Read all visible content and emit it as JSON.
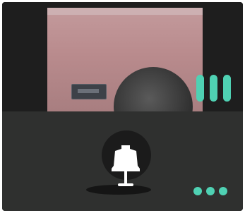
{
  "screen": {
    "camera": {
      "label": ""
    },
    "controls": {
      "stream_bars": 3,
      "more_dots": 3
    },
    "colors": {
      "accent": "#4fd1b3",
      "panel": "#2f302f",
      "bell": "#ffffff"
    }
  }
}
